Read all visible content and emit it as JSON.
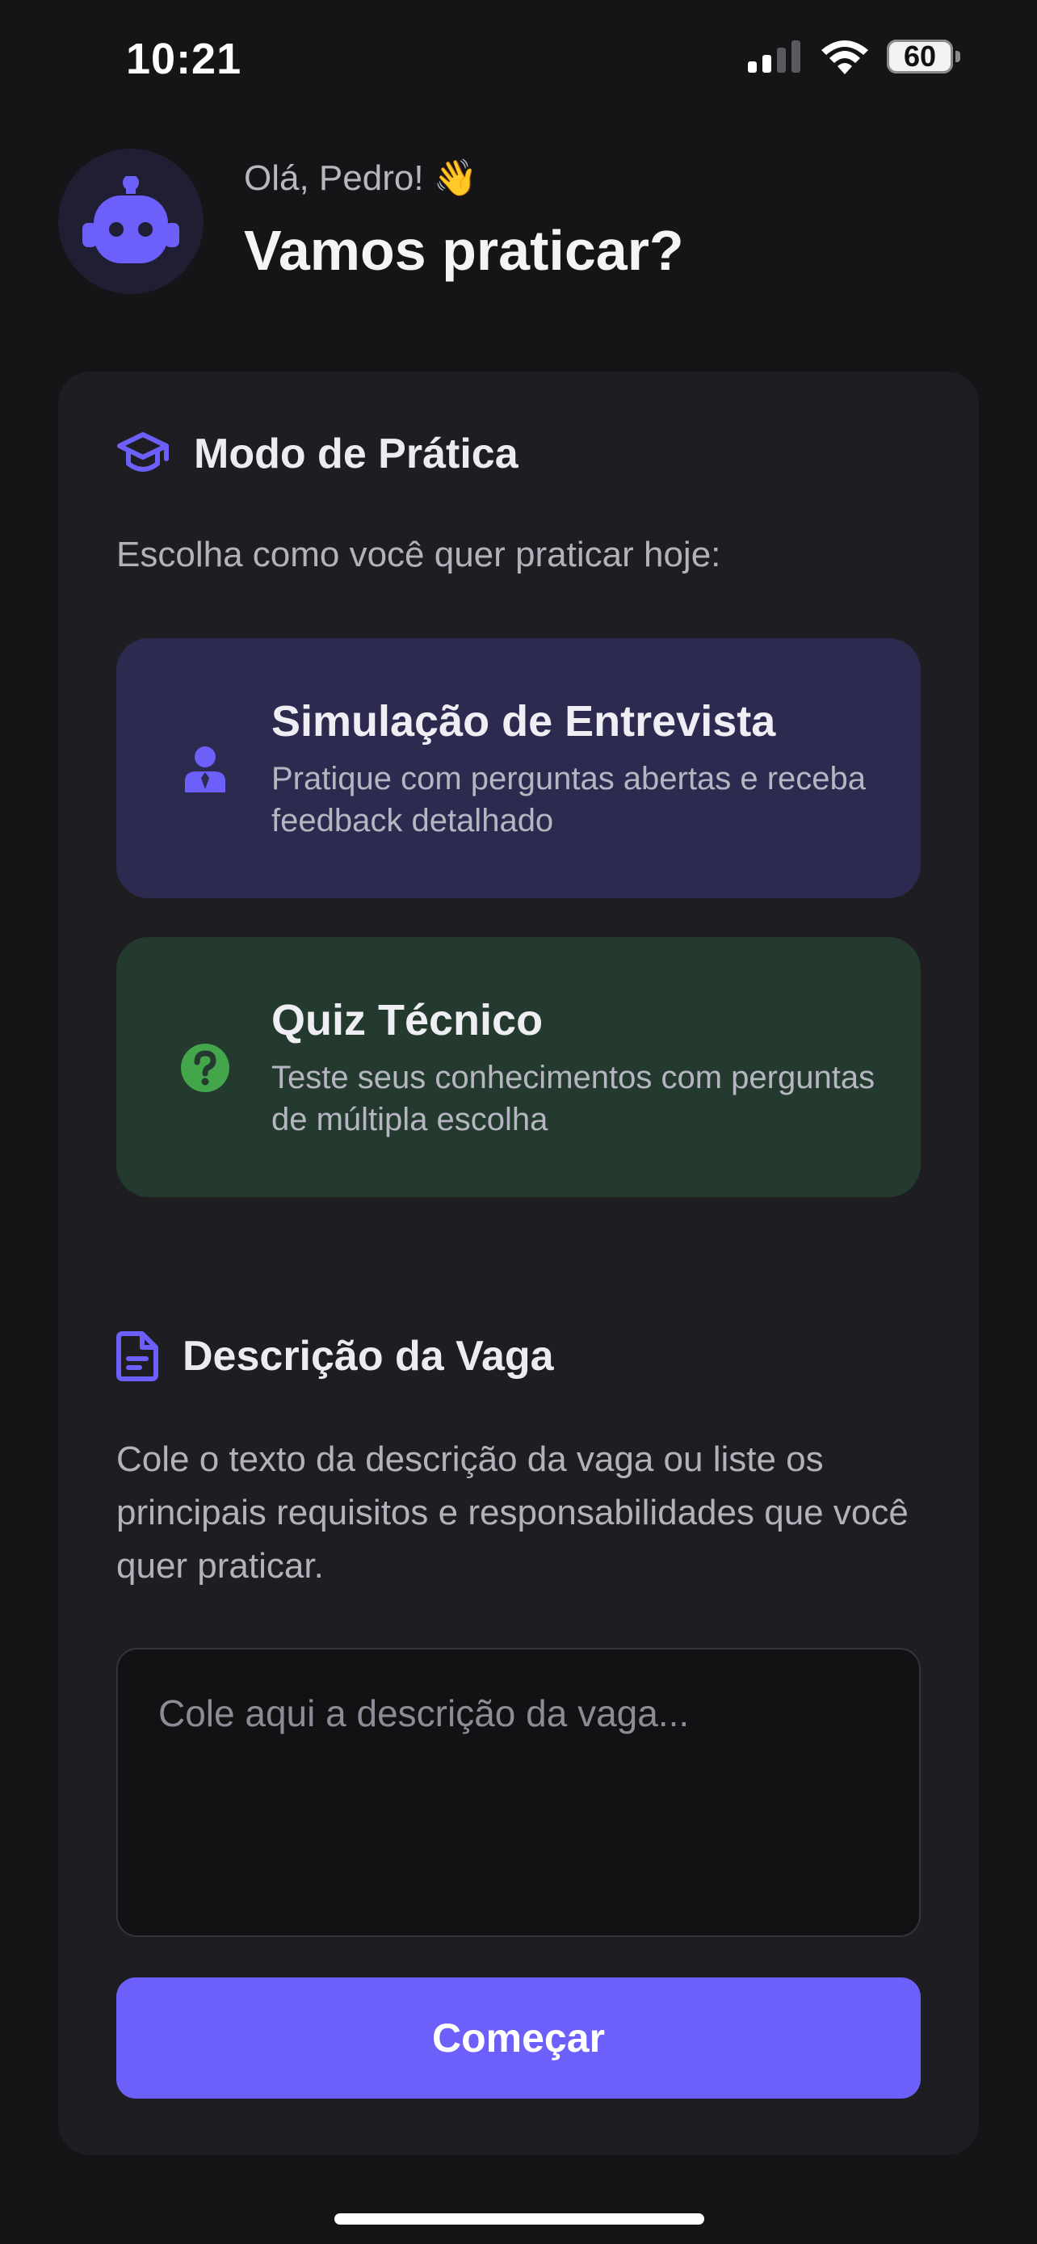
{
  "status_bar": {
    "time": "10:21",
    "battery_level": "60",
    "icons": [
      "cellular-signal-icon",
      "wifi-icon",
      "battery-icon"
    ]
  },
  "header": {
    "avatar_icon": "robot-icon",
    "greeting": "Olá, Pedro! 👋",
    "title": "Vamos praticar?"
  },
  "practice_mode": {
    "icon": "graduation-cap-icon",
    "title": "Modo de Prática",
    "description": "Escolha como você quer praticar hoje:",
    "options": [
      {
        "icon": "user-tie-icon",
        "title": "Simulação de Entrevista",
        "description": "Pratique com perguntas abertas e receba feedback detalhado",
        "color": "#2c2a4e"
      },
      {
        "icon": "question-circle-icon",
        "title": "Quiz Técnico",
        "description": "Teste seus conhecimentos com perguntas de múltipla escolha",
        "color": "#253a2e"
      }
    ]
  },
  "job_description": {
    "icon": "document-icon",
    "title": "Descrição da Vaga",
    "description": "Cole o texto da descrição da vaga ou liste os principais requisitos e responsabilidades que você quer praticar.",
    "placeholder": "Cole aqui a descrição da vaga...",
    "value": ""
  },
  "start_button": {
    "label": "Começar"
  },
  "colors": {
    "accent": "#6c5ffa",
    "background": "#151517",
    "card": "#1e1e22",
    "success": "#43a64a"
  }
}
